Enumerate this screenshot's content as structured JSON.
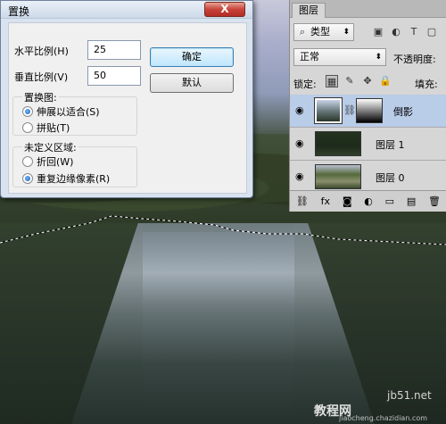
{
  "dialog": {
    "title": "置换",
    "close_label": "X",
    "horizontal_scale_label": "水平比例(H)",
    "horizontal_scale_value": "25",
    "vertical_scale_label": "垂直比例(V)",
    "vertical_scale_value": "50",
    "ok_label": "确定",
    "default_label": "默认",
    "displacement_map": {
      "title": "置换图:",
      "options": [
        "伸展以适合(S)",
        "拼贴(T)"
      ],
      "selected": "伸展以适合(S)"
    },
    "undefined_areas": {
      "title": "未定义区域:",
      "options": [
        "折回(W)",
        "重复边缘像素(R)"
      ],
      "selected": "重复边缘像素(R)"
    }
  },
  "layers_panel": {
    "tab": "图层",
    "filter_kind": "类型",
    "blend_mode": "正常",
    "opacity_label": "不透明度:",
    "lock_label": "锁定:",
    "fill_label": "填充:",
    "layers": [
      {
        "name": "倒影",
        "active": true,
        "has_mask": true
      },
      {
        "name": "图层 1",
        "active": false,
        "has_mask": false
      },
      {
        "name": "图层 0",
        "active": false,
        "has_mask": false
      }
    ]
  },
  "watermark": {
    "site": "jb51.net",
    "text": "教程网",
    "url": "jiaocheng.chazidian.com"
  }
}
